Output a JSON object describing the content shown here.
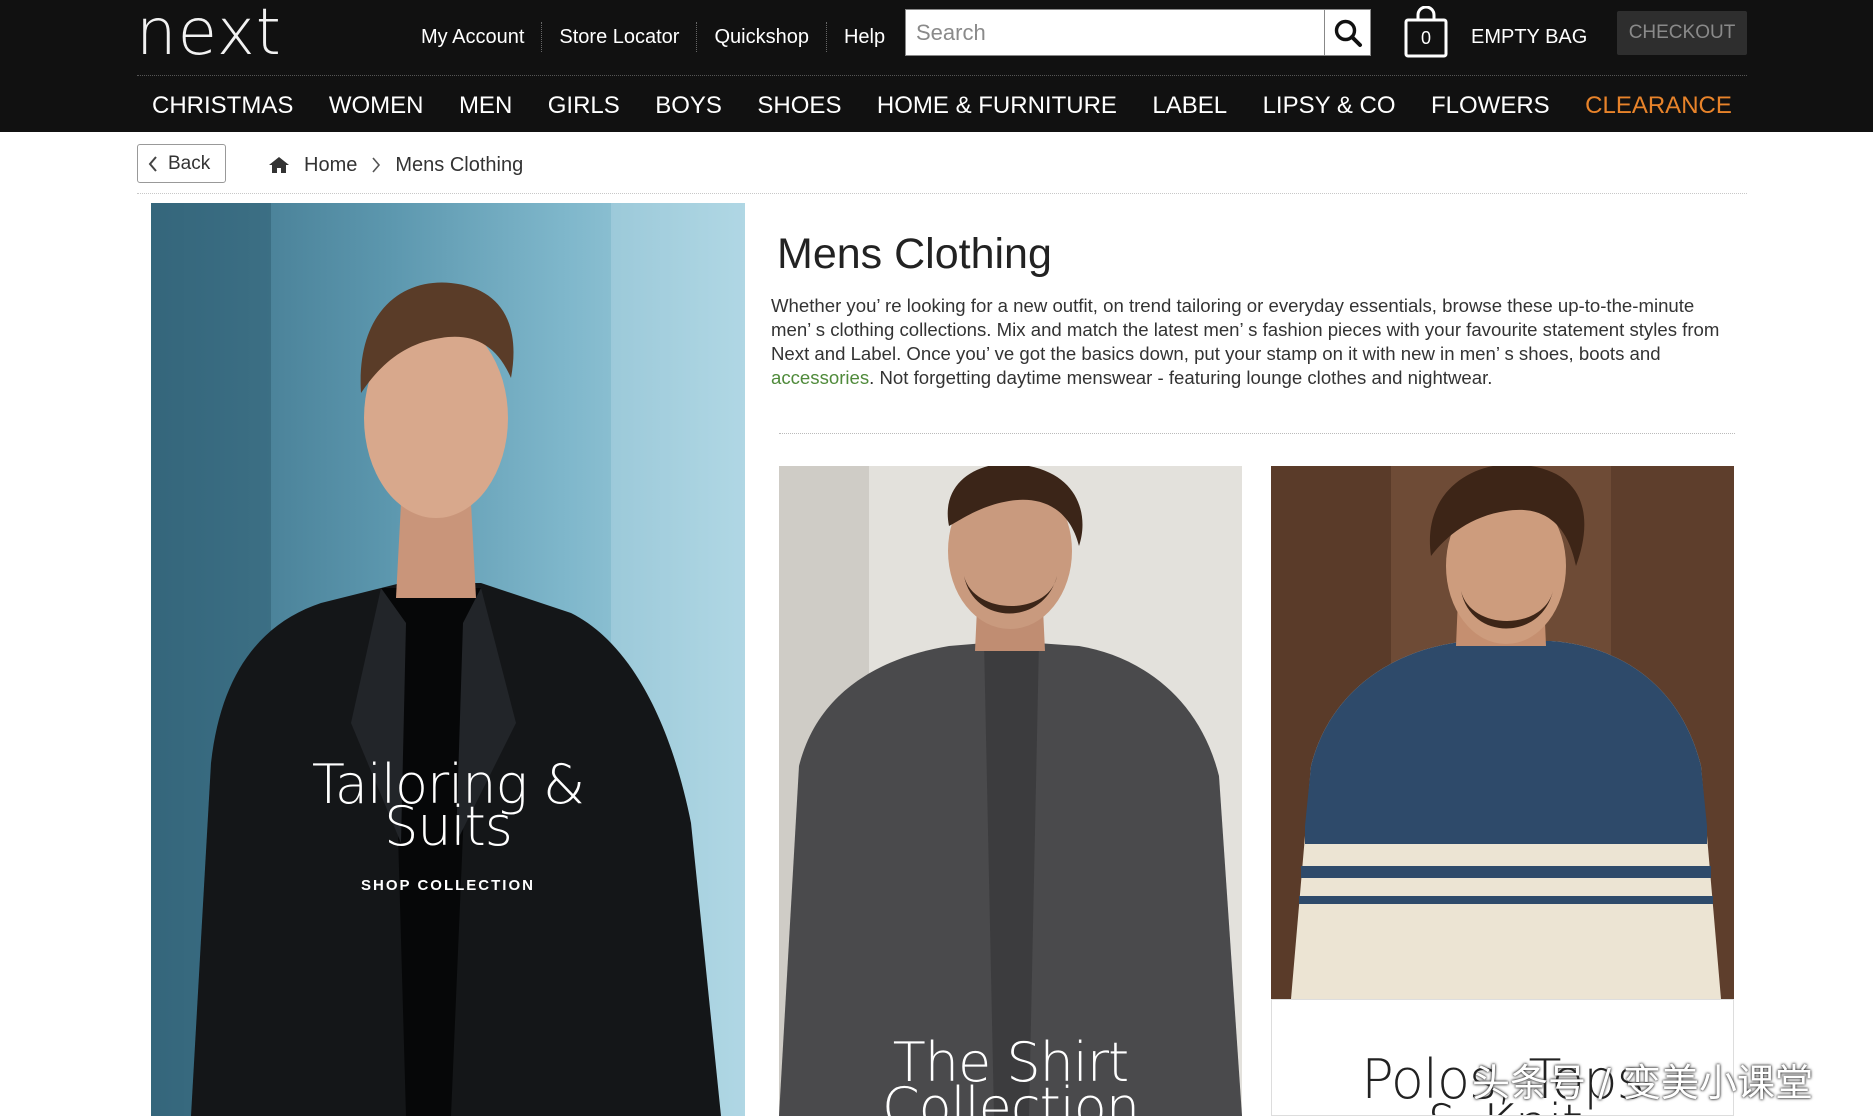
{
  "header": {
    "logo": "next",
    "utility_links": [
      "My Account",
      "Store Locator",
      "Quickshop",
      "Help"
    ],
    "search_placeholder": "Search",
    "bag_count": "0",
    "bag_label": "EMPTY BAG",
    "checkout_label": "CHECKOUT"
  },
  "nav": {
    "items": [
      "CHRISTMAS",
      "WOMEN",
      "MEN",
      "GIRLS",
      "BOYS",
      "SHOES",
      "HOME & FURNITURE",
      "LABEL",
      "LIPSY & CO",
      "FLOWERS",
      "CLEARANCE"
    ],
    "highlight_color": "#e8832a"
  },
  "breadcrumb": {
    "back_label": "Back",
    "items": [
      "Home",
      "Mens Clothing"
    ]
  },
  "hero": {
    "title_line1": "Tailoring &",
    "title_line2": "Suits",
    "cta": "SHOP COLLECTION"
  },
  "intro": {
    "title": "Mens Clothing",
    "text_before_link": "Whether you’ re looking for a new outfit, on trend tailoring or everyday essentials, browse these up-to-the-minute men’ s clothing collections. Mix and match the latest men’ s fashion pieces with your favourite statement styles from Next and Label. Once you’ ve got the basics down, put your stamp on it with new in men’ s shoes, boots and ",
    "link_text": "accessories",
    "text_after_link": ". Not forgetting daytime menswear - featuring lounge clothes and nightwear.",
    "link_color": "#4f8a3a"
  },
  "tiles": {
    "shirt_line1": "The Shirt",
    "shirt_line2": "Collection",
    "knit_line1": "Polos, Tops",
    "knit_line2": "& Knit"
  },
  "watermark": "头条号 / 变美小课堂",
  "colors": {
    "header_bg": "#111111",
    "accent": "#e8832a"
  }
}
